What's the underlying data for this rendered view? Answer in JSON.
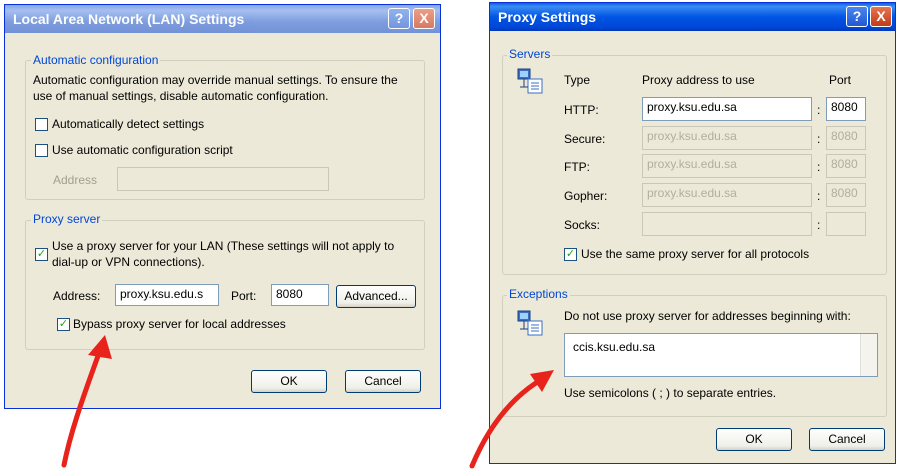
{
  "lan": {
    "title": "Local Area Network (LAN) Settings",
    "help": "?",
    "close": "X",
    "auto_group": "Automatic configuration",
    "auto_desc_1": "Automatic configuration may override manual settings.  To ensure the",
    "auto_desc_2": "use of manual settings, disable automatic configuration.",
    "auto_detect": "Automatically detect settings",
    "auto_script": "Use automatic configuration script",
    "address_label": "Address",
    "address_value": "",
    "proxy_group": "Proxy server",
    "use_proxy_1": "Use a proxy server for your LAN (These settings will not apply to",
    "use_proxy_2": "dial-up or VPN connections).",
    "addr_label": "Address:",
    "addr_value": "proxy.ksu.edu.s",
    "port_label": "Port:",
    "port_value": "8080",
    "advanced": "Advanced...",
    "bypass": "Bypass proxy server for local addresses",
    "ok": "OK",
    "cancel": "Cancel"
  },
  "proxy": {
    "title": "Proxy Settings",
    "help": "?",
    "close": "X",
    "servers_group": "Servers",
    "col_type": "Type",
    "col_address": "Proxy address to use",
    "col_port": "Port",
    "rows": [
      {
        "type": "HTTP:",
        "address": "proxy.ksu.edu.sa",
        "port": "8080",
        "colon": ":"
      },
      {
        "type": "Secure:",
        "address": "proxy.ksu.edu.sa",
        "port": "8080",
        "colon": ":"
      },
      {
        "type": "FTP:",
        "address": "proxy.ksu.edu.sa",
        "port": "8080",
        "colon": ":"
      },
      {
        "type": "Gopher:",
        "address": "proxy.ksu.edu.sa",
        "port": "8080",
        "colon": ":"
      },
      {
        "type": "Socks:",
        "address": "",
        "port": "",
        "colon": ":"
      }
    ],
    "same_proxy": "Use the same proxy server for all protocols",
    "exceptions_group": "Exceptions",
    "exceptions_desc": "Do not use proxy server for addresses beginning with:",
    "exceptions_value": "ccis.ksu.edu.sa",
    "semicolons": "Use semicolons ( ; ) to separate entries.",
    "ok": "OK",
    "cancel": "Cancel"
  },
  "colors": {
    "annotation_arrow": "#e8231c",
    "group_label": "#0046d5",
    "title_blue": "#0055e5"
  }
}
